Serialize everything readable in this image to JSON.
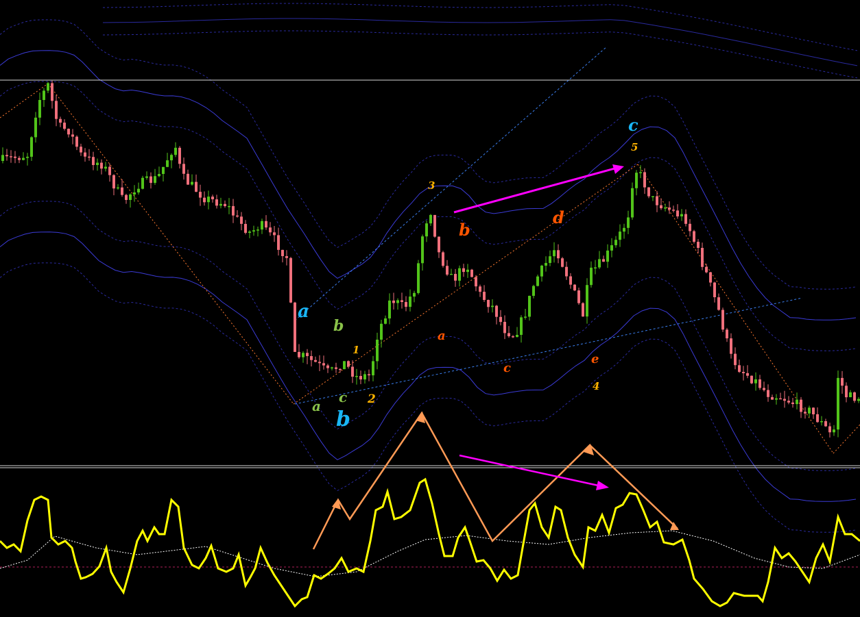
{
  "chart_data": {
    "type": "candlestick",
    "title": "",
    "xlabel": "",
    "ylabel": "",
    "grid": false,
    "legend": "none",
    "colors": {
      "background": "#000000",
      "bull_candle": "#52c41a",
      "bear_candle": "#f0707c",
      "oscillator": "#ffff00",
      "signal": "#ffffff",
      "zero_line": "#b0205a",
      "channel": "#3b3bd6",
      "annotation_arrow": "#ff9a55",
      "divergence_arrow": "#ff00ff",
      "separator": "#d8d8d8"
    },
    "price_path": [
      [
        0,
        235
      ],
      [
        40,
        226
      ],
      [
        55,
        150
      ],
      [
        70,
        124
      ],
      [
        85,
        185
      ],
      [
        100,
        190
      ],
      [
        120,
        230
      ],
      [
        150,
        240
      ],
      [
        180,
        295
      ],
      [
        200,
        270
      ],
      [
        230,
        260
      ],
      [
        255,
        210
      ],
      [
        265,
        258
      ],
      [
        300,
        290
      ],
      [
        330,
        298
      ],
      [
        345,
        320
      ],
      [
        365,
        340
      ],
      [
        380,
        328
      ],
      [
        400,
        350
      ],
      [
        420,
        378
      ],
      [
        428,
        520
      ],
      [
        440,
        520
      ],
      [
        460,
        530
      ],
      [
        480,
        545
      ],
      [
        500,
        528
      ],
      [
        520,
        550
      ],
      [
        540,
        548
      ],
      [
        550,
        490
      ],
      [
        570,
        436
      ],
      [
        590,
        450
      ],
      [
        605,
        420
      ],
      [
        618,
        330
      ],
      [
        628,
        308
      ],
      [
        640,
        370
      ],
      [
        660,
        410
      ],
      [
        680,
        385
      ],
      [
        700,
        430
      ],
      [
        720,
        450
      ],
      [
        735,
        480
      ],
      [
        750,
        490
      ],
      [
        765,
        460
      ],
      [
        780,
        410
      ],
      [
        790,
        395
      ],
      [
        810,
        360
      ],
      [
        830,
        410
      ],
      [
        850,
        460
      ],
      [
        860,
        400
      ],
      [
        880,
        380
      ],
      [
        900,
        350
      ],
      [
        915,
        320
      ],
      [
        925,
        245
      ],
      [
        935,
        258
      ],
      [
        950,
        290
      ],
      [
        975,
        305
      ],
      [
        1000,
        320
      ],
      [
        1015,
        360
      ],
      [
        1030,
        400
      ],
      [
        1050,
        460
      ],
      [
        1065,
        520
      ],
      [
        1080,
        540
      ],
      [
        1100,
        555
      ],
      [
        1120,
        575
      ],
      [
        1140,
        580
      ],
      [
        1160,
        590
      ],
      [
        1180,
        600
      ],
      [
        1200,
        620
      ],
      [
        1215,
        640
      ],
      [
        1222,
        550
      ],
      [
        1235,
        580
      ],
      [
        1254,
        580
      ]
    ],
    "oscillator": [
      [
        0,
        790
      ],
      [
        10,
        800
      ],
      [
        20,
        795
      ],
      [
        30,
        805
      ],
      [
        40,
        760
      ],
      [
        50,
        730
      ],
      [
        60,
        725
      ],
      [
        70,
        730
      ],
      [
        75,
        785
      ],
      [
        85,
        795
      ],
      [
        95,
        790
      ],
      [
        105,
        800
      ],
      [
        110,
        820
      ],
      [
        118,
        845
      ],
      [
        125,
        843
      ],
      [
        135,
        838
      ],
      [
        145,
        827
      ],
      [
        155,
        800
      ],
      [
        162,
        835
      ],
      [
        170,
        850
      ],
      [
        180,
        865
      ],
      [
        190,
        830
      ],
      [
        200,
        790
      ],
      [
        208,
        775
      ],
      [
        215,
        790
      ],
      [
        225,
        770
      ],
      [
        232,
        780
      ],
      [
        240,
        780
      ],
      [
        250,
        730
      ],
      [
        260,
        740
      ],
      [
        268,
        800
      ],
      [
        280,
        825
      ],
      [
        290,
        830
      ],
      [
        300,
        815
      ],
      [
        308,
        797
      ],
      [
        318,
        830
      ],
      [
        330,
        835
      ],
      [
        340,
        830
      ],
      [
        348,
        810
      ],
      [
        358,
        855
      ],
      [
        365,
        843
      ],
      [
        372,
        830
      ],
      [
        380,
        800
      ],
      [
        390,
        822
      ],
      [
        400,
        840
      ],
      [
        410,
        855
      ],
      [
        420,
        870
      ],
      [
        430,
        885
      ],
      [
        440,
        875
      ],
      [
        448,
        872
      ],
      [
        458,
        840
      ],
      [
        468,
        845
      ],
      [
        478,
        838
      ],
      [
        488,
        830
      ],
      [
        498,
        815
      ],
      [
        508,
        835
      ],
      [
        520,
        830
      ],
      [
        530,
        835
      ],
      [
        540,
        790
      ],
      [
        548,
        745
      ],
      [
        558,
        740
      ],
      [
        565,
        718
      ],
      [
        575,
        758
      ],
      [
        585,
        755
      ],
      [
        598,
        745
      ],
      [
        612,
        705
      ],
      [
        620,
        700
      ],
      [
        630,
        735
      ],
      [
        640,
        780
      ],
      [
        648,
        812
      ],
      [
        660,
        812
      ],
      [
        668,
        785
      ],
      [
        678,
        770
      ],
      [
        685,
        790
      ],
      [
        695,
        820
      ],
      [
        705,
        818
      ],
      [
        715,
        830
      ],
      [
        725,
        848
      ],
      [
        735,
        832
      ],
      [
        745,
        845
      ],
      [
        755,
        840
      ],
      [
        762,
        800
      ],
      [
        772,
        745
      ],
      [
        780,
        735
      ],
      [
        790,
        770
      ],
      [
        800,
        785
      ],
      [
        810,
        740
      ],
      [
        818,
        745
      ],
      [
        828,
        785
      ],
      [
        838,
        810
      ],
      [
        850,
        828
      ],
      [
        858,
        770
      ],
      [
        868,
        775
      ],
      [
        878,
        752
      ],
      [
        888,
        778
      ],
      [
        898,
        742
      ],
      [
        908,
        737
      ],
      [
        918,
        720
      ],
      [
        928,
        722
      ],
      [
        938,
        745
      ],
      [
        948,
        770
      ],
      [
        958,
        762
      ],
      [
        968,
        792
      ],
      [
        982,
        795
      ],
      [
        995,
        788
      ],
      [
        1005,
        818
      ],
      [
        1012,
        845
      ],
      [
        1025,
        860
      ],
      [
        1038,
        878
      ],
      [
        1050,
        885
      ],
      [
        1060,
        880
      ],
      [
        1070,
        866
      ],
      [
        1085,
        870
      ],
      [
        1095,
        870
      ],
      [
        1105,
        870
      ],
      [
        1112,
        878
      ],
      [
        1120,
        850
      ],
      [
        1130,
        800
      ],
      [
        1140,
        815
      ],
      [
        1150,
        808
      ],
      [
        1160,
        820
      ],
      [
        1170,
        835
      ],
      [
        1180,
        850
      ],
      [
        1190,
        815
      ],
      [
        1200,
        795
      ],
      [
        1210,
        820
      ],
      [
        1222,
        755
      ],
      [
        1232,
        780
      ],
      [
        1242,
        780
      ],
      [
        1254,
        790
      ]
    ],
    "signal": [
      [
        0,
        830
      ],
      [
        40,
        818
      ],
      [
        80,
        783
      ],
      [
        140,
        800
      ],
      [
        200,
        810
      ],
      [
        300,
        798
      ],
      [
        400,
        830
      ],
      [
        460,
        842
      ],
      [
        520,
        835
      ],
      [
        580,
        805
      ],
      [
        620,
        788
      ],
      [
        680,
        782
      ],
      [
        740,
        790
      ],
      [
        800,
        795
      ],
      [
        860,
        785
      ],
      [
        920,
        778
      ],
      [
        980,
        775
      ],
      [
        1040,
        790
      ],
      [
        1100,
        815
      ],
      [
        1150,
        828
      ],
      [
        1200,
        830
      ],
      [
        1254,
        810
      ]
    ],
    "wave_labels": {
      "cyan": [
        "a",
        "b",
        "c"
      ],
      "orange": [
        "a",
        "b",
        "c",
        "d",
        "e"
      ],
      "green": [
        "a",
        "b",
        "c"
      ],
      "numbers": [
        "1",
        "2",
        "3",
        "4",
        "5"
      ]
    }
  }
}
